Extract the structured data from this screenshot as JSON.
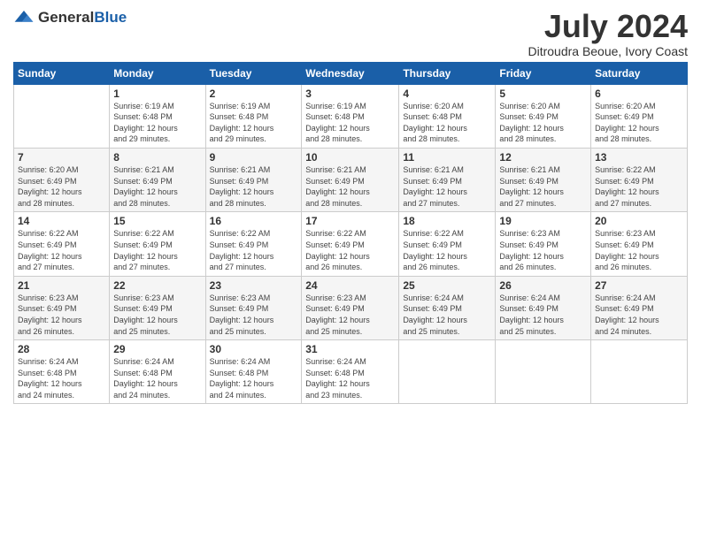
{
  "logo": {
    "text_general": "General",
    "text_blue": "Blue"
  },
  "title": "July 2024",
  "subtitle": "Ditroudra Beoue, Ivory Coast",
  "days_of_week": [
    "Sunday",
    "Monday",
    "Tuesday",
    "Wednesday",
    "Thursday",
    "Friday",
    "Saturday"
  ],
  "weeks": [
    [
      {
        "day": "",
        "info": ""
      },
      {
        "day": "1",
        "info": "Sunrise: 6:19 AM\nSunset: 6:48 PM\nDaylight: 12 hours\nand 29 minutes."
      },
      {
        "day": "2",
        "info": "Sunrise: 6:19 AM\nSunset: 6:48 PM\nDaylight: 12 hours\nand 29 minutes."
      },
      {
        "day": "3",
        "info": "Sunrise: 6:19 AM\nSunset: 6:48 PM\nDaylight: 12 hours\nand 28 minutes."
      },
      {
        "day": "4",
        "info": "Sunrise: 6:20 AM\nSunset: 6:48 PM\nDaylight: 12 hours\nand 28 minutes."
      },
      {
        "day": "5",
        "info": "Sunrise: 6:20 AM\nSunset: 6:49 PM\nDaylight: 12 hours\nand 28 minutes."
      },
      {
        "day": "6",
        "info": "Sunrise: 6:20 AM\nSunset: 6:49 PM\nDaylight: 12 hours\nand 28 minutes."
      }
    ],
    [
      {
        "day": "7",
        "info": "Sunrise: 6:20 AM\nSunset: 6:49 PM\nDaylight: 12 hours\nand 28 minutes."
      },
      {
        "day": "8",
        "info": "Sunrise: 6:21 AM\nSunset: 6:49 PM\nDaylight: 12 hours\nand 28 minutes."
      },
      {
        "day": "9",
        "info": "Sunrise: 6:21 AM\nSunset: 6:49 PM\nDaylight: 12 hours\nand 28 minutes."
      },
      {
        "day": "10",
        "info": "Sunrise: 6:21 AM\nSunset: 6:49 PM\nDaylight: 12 hours\nand 28 minutes."
      },
      {
        "day": "11",
        "info": "Sunrise: 6:21 AM\nSunset: 6:49 PM\nDaylight: 12 hours\nand 27 minutes."
      },
      {
        "day": "12",
        "info": "Sunrise: 6:21 AM\nSunset: 6:49 PM\nDaylight: 12 hours\nand 27 minutes."
      },
      {
        "day": "13",
        "info": "Sunrise: 6:22 AM\nSunset: 6:49 PM\nDaylight: 12 hours\nand 27 minutes."
      }
    ],
    [
      {
        "day": "14",
        "info": "Sunrise: 6:22 AM\nSunset: 6:49 PM\nDaylight: 12 hours\nand 27 minutes."
      },
      {
        "day": "15",
        "info": "Sunrise: 6:22 AM\nSunset: 6:49 PM\nDaylight: 12 hours\nand 27 minutes."
      },
      {
        "day": "16",
        "info": "Sunrise: 6:22 AM\nSunset: 6:49 PM\nDaylight: 12 hours\nand 27 minutes."
      },
      {
        "day": "17",
        "info": "Sunrise: 6:22 AM\nSunset: 6:49 PM\nDaylight: 12 hours\nand 26 minutes."
      },
      {
        "day": "18",
        "info": "Sunrise: 6:22 AM\nSunset: 6:49 PM\nDaylight: 12 hours\nand 26 minutes."
      },
      {
        "day": "19",
        "info": "Sunrise: 6:23 AM\nSunset: 6:49 PM\nDaylight: 12 hours\nand 26 minutes."
      },
      {
        "day": "20",
        "info": "Sunrise: 6:23 AM\nSunset: 6:49 PM\nDaylight: 12 hours\nand 26 minutes."
      }
    ],
    [
      {
        "day": "21",
        "info": "Sunrise: 6:23 AM\nSunset: 6:49 PM\nDaylight: 12 hours\nand 26 minutes."
      },
      {
        "day": "22",
        "info": "Sunrise: 6:23 AM\nSunset: 6:49 PM\nDaylight: 12 hours\nand 25 minutes."
      },
      {
        "day": "23",
        "info": "Sunrise: 6:23 AM\nSunset: 6:49 PM\nDaylight: 12 hours\nand 25 minutes."
      },
      {
        "day": "24",
        "info": "Sunrise: 6:23 AM\nSunset: 6:49 PM\nDaylight: 12 hours\nand 25 minutes."
      },
      {
        "day": "25",
        "info": "Sunrise: 6:24 AM\nSunset: 6:49 PM\nDaylight: 12 hours\nand 25 minutes."
      },
      {
        "day": "26",
        "info": "Sunrise: 6:24 AM\nSunset: 6:49 PM\nDaylight: 12 hours\nand 25 minutes."
      },
      {
        "day": "27",
        "info": "Sunrise: 6:24 AM\nSunset: 6:49 PM\nDaylight: 12 hours\nand 24 minutes."
      }
    ],
    [
      {
        "day": "28",
        "info": "Sunrise: 6:24 AM\nSunset: 6:48 PM\nDaylight: 12 hours\nand 24 minutes."
      },
      {
        "day": "29",
        "info": "Sunrise: 6:24 AM\nSunset: 6:48 PM\nDaylight: 12 hours\nand 24 minutes."
      },
      {
        "day": "30",
        "info": "Sunrise: 6:24 AM\nSunset: 6:48 PM\nDaylight: 12 hours\nand 24 minutes."
      },
      {
        "day": "31",
        "info": "Sunrise: 6:24 AM\nSunset: 6:48 PM\nDaylight: 12 hours\nand 23 minutes."
      },
      {
        "day": "",
        "info": ""
      },
      {
        "day": "",
        "info": ""
      },
      {
        "day": "",
        "info": ""
      }
    ]
  ]
}
